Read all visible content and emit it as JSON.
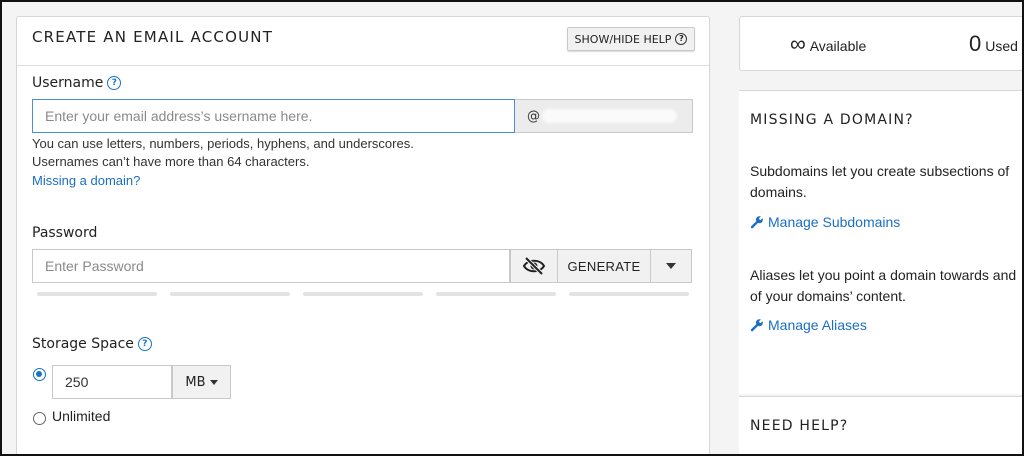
{
  "form": {
    "title": "CREATE AN EMAIL ACCOUNT",
    "help_button": "SHOW/HIDE HELP",
    "username": {
      "label": "Username",
      "placeholder": "Enter your email address’s username here.",
      "domain_prefix": "@",
      "help_line1": "You can use letters, numbers, periods, hyphens, and underscores.",
      "help_line2": "Usernames can’t have more than 64 characters.",
      "missing_domain_link": "Missing a domain?"
    },
    "password": {
      "label": "Password",
      "placeholder": "Enter Password",
      "generate_label": "GENERATE"
    },
    "storage": {
      "label": "Storage Space",
      "value": "250",
      "unit": "MB",
      "unlimited_label": "Unlimited",
      "selected": "limited"
    }
  },
  "usage": {
    "available_value": "∞",
    "available_label": "Available",
    "used_value": "0",
    "used_label": "Used"
  },
  "sidebar": {
    "missing_domain": {
      "title": "MISSING A DOMAIN?",
      "subdomains_text_line1": "Subdomains let you create subsections of",
      "subdomains_text_line2": "domains.",
      "subdomains_link": "Manage Subdomains",
      "aliases_text_line1": "Aliases let you point a domain towards and",
      "aliases_text_line2": "of your domains’ content.",
      "aliases_link": "Manage Aliases"
    },
    "need_help": {
      "title": "NEED HELP?"
    }
  },
  "colors": {
    "accent": "#1a73c8",
    "link": "#1a6fc4",
    "focus_border": "#4a90d9"
  }
}
